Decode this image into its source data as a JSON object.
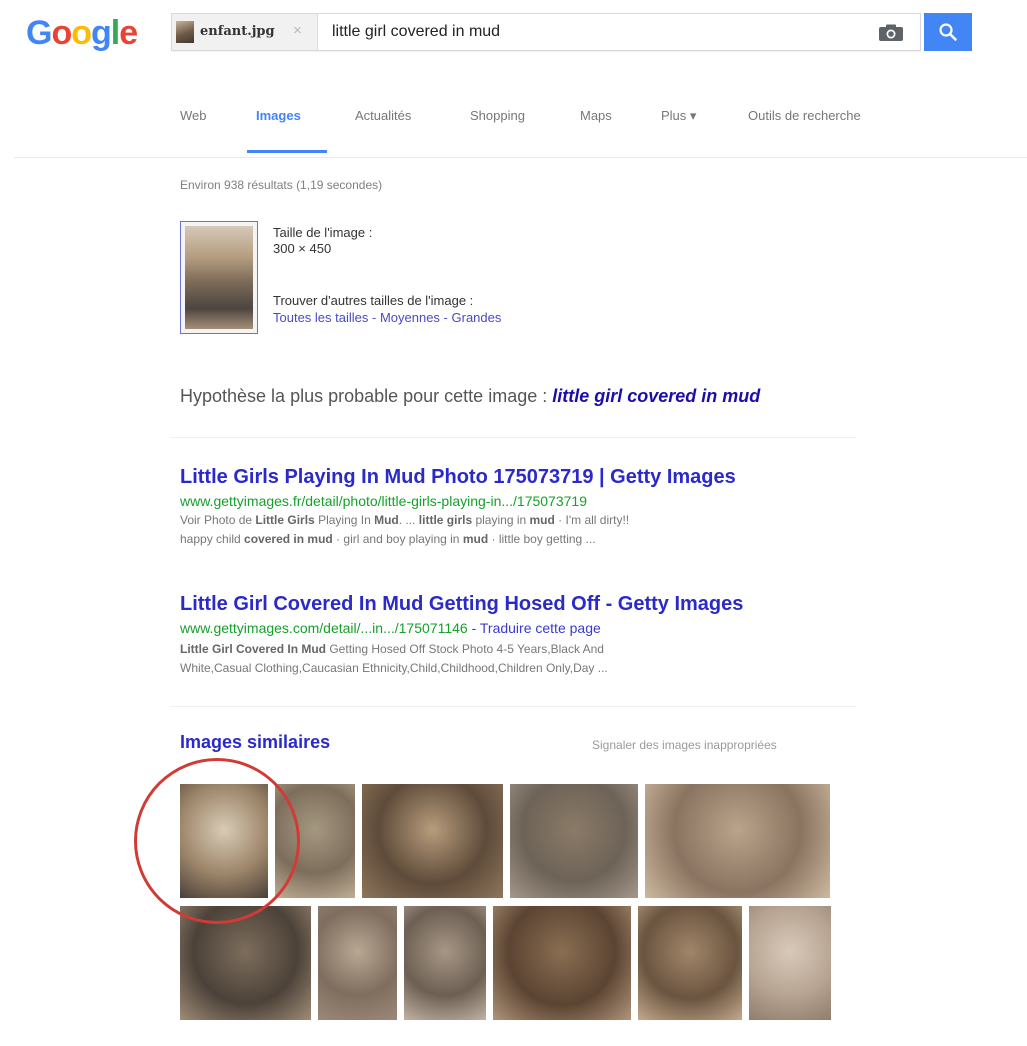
{
  "header": {
    "logo_letters": [
      {
        "char": "G",
        "color": "#4285f4"
      },
      {
        "char": "o",
        "color": "#ea4335"
      },
      {
        "char": "o",
        "color": "#fbbc05"
      },
      {
        "char": "g",
        "color": "#4285f4"
      },
      {
        "char": "l",
        "color": "#34a853"
      },
      {
        "char": "e",
        "color": "#ea4335"
      }
    ],
    "image_chip": {
      "filename": "enfant.jpg",
      "close_symbol": "×"
    },
    "query": "little girl covered in mud",
    "camera_icon": "camera-icon",
    "search_icon": "search-icon",
    "accent_color": "#4285f4"
  },
  "tabs": {
    "web": "Web",
    "images": "Images",
    "news": "Actualités",
    "shopping": "Shopping",
    "maps": "Maps",
    "more": "Plus ▾",
    "tools": "Outils de recherche",
    "active": "images"
  },
  "results_count": "Environ 938 résultats (1,19 secondes)",
  "image_info": {
    "size_label": "Taille de l'image :",
    "size_value": "300 × 450",
    "other_sizes_label": "Trouver d'autres tailles de l'image :",
    "size_links": [
      "Toutes les tailles",
      "Moyennes",
      "Grandes"
    ],
    "separator": " - "
  },
  "best_guess": {
    "prefix": "Hypothèse la plus probable pour cette image : ",
    "link": "little girl covered in mud"
  },
  "results": [
    {
      "title": "Little Girls Playing In Mud Photo 175073719 | Getty Images",
      "url": "www.gettyimages.fr/detail/photo/little-girls-playing-in.../175073719",
      "snippet_line1": [
        {
          "t": "Voir Photo de ",
          "b": false
        },
        {
          "t": "Little Girls",
          "b": true
        },
        {
          "t": " Playing In ",
          "b": false
        },
        {
          "t": "Mud",
          "b": true
        },
        {
          "t": ". ... ",
          "b": false
        },
        {
          "t": "little girls",
          "b": true
        },
        {
          "t": " playing in ",
          "b": false
        },
        {
          "t": "mud",
          "b": true
        },
        {
          "t": " · I'm all dirty!!",
          "b": false
        }
      ],
      "snippet_line2": [
        {
          "t": "happy child ",
          "b": false
        },
        {
          "t": "covered in mud",
          "b": true
        },
        {
          "t": " · girl and boy playing in ",
          "b": false
        },
        {
          "t": "mud",
          "b": true
        },
        {
          "t": " · little boy getting ...",
          "b": false
        }
      ]
    },
    {
      "title": "Little Girl Covered In Mud Getting Hosed Off - Getty Images",
      "url": "www.gettyimages.com/detail/...in.../175071146",
      "translate": " - Traduire cette page",
      "snippet_line1": [
        {
          "t": "Little Girl Covered In Mud",
          "b": true
        },
        {
          "t": " Getting Hosed Off Stock Photo 4-5 Years,Black And",
          "b": false
        }
      ],
      "snippet_line2": [
        {
          "t": "White,Casual Clothing,Caucasian Ethnicity,Child,Childhood,Children Only,Day ...",
          "b": false
        }
      ]
    }
  ],
  "similar": {
    "heading": "Images similaires",
    "report": "Signaler des images inappropriées",
    "highlight_color": "#d23b35",
    "row1": [
      {
        "w": 88,
        "colors": [
          "#d8cbb6",
          "#9c8569",
          "#4a4038"
        ]
      },
      {
        "w": 80,
        "colors": [
          "#a59880",
          "#7d6e5c",
          "#bfae95"
        ]
      },
      {
        "w": 141,
        "colors": [
          "#b89c7c",
          "#5e4b3a",
          "#8e765c"
        ]
      },
      {
        "w": 128,
        "colors": [
          "#8b7a67",
          "#6d6357",
          "#a4968a"
        ]
      },
      {
        "w": 185,
        "colors": [
          "#bba48b",
          "#8a7360",
          "#cdb9a0"
        ]
      }
    ],
    "row2": [
      {
        "w": 131,
        "colors": [
          "#7d6d5c",
          "#4c4239",
          "#a08c76"
        ]
      },
      {
        "w": 79,
        "colors": [
          "#b8a892",
          "#7f6d5f",
          "#9c8978"
        ]
      },
      {
        "w": 82,
        "colors": [
          "#a69785",
          "#6d5f53",
          "#c2b4a3"
        ]
      },
      {
        "w": 138,
        "colors": [
          "#8a6e52",
          "#5b4432",
          "#b0957a"
        ]
      },
      {
        "w": 104,
        "colors": [
          "#a08669",
          "#6b5440",
          "#c3aa8c"
        ]
      },
      {
        "w": 82,
        "colors": [
          "#d9c9b9",
          "#b7a493",
          "#8f7d6d"
        ]
      }
    ]
  }
}
